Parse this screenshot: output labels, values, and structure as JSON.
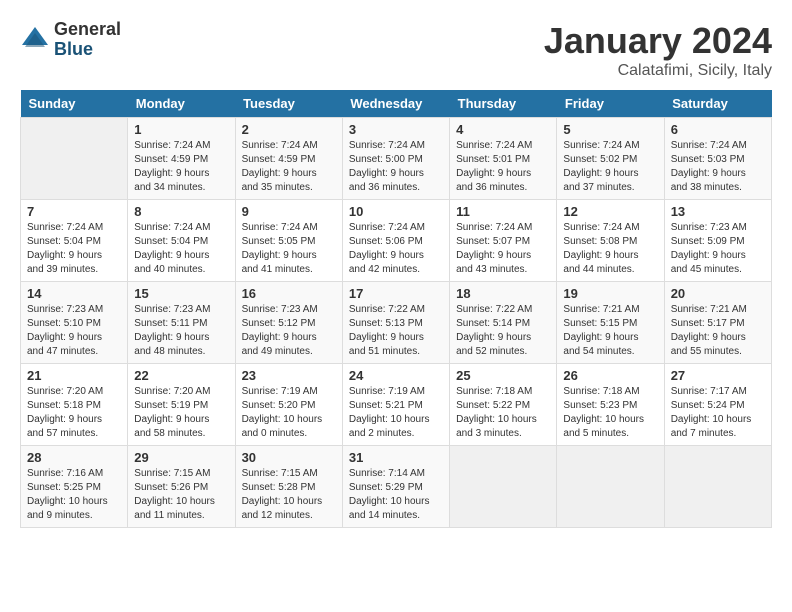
{
  "logo": {
    "general": "General",
    "blue": "Blue"
  },
  "title": "January 2024",
  "location": "Calatafimi, Sicily, Italy",
  "days_of_week": [
    "Sunday",
    "Monday",
    "Tuesday",
    "Wednesday",
    "Thursday",
    "Friday",
    "Saturday"
  ],
  "weeks": [
    [
      {
        "day": "",
        "info": ""
      },
      {
        "day": "1",
        "info": "Sunrise: 7:24 AM\nSunset: 4:59 PM\nDaylight: 9 hours\nand 34 minutes."
      },
      {
        "day": "2",
        "info": "Sunrise: 7:24 AM\nSunset: 4:59 PM\nDaylight: 9 hours\nand 35 minutes."
      },
      {
        "day": "3",
        "info": "Sunrise: 7:24 AM\nSunset: 5:00 PM\nDaylight: 9 hours\nand 36 minutes."
      },
      {
        "day": "4",
        "info": "Sunrise: 7:24 AM\nSunset: 5:01 PM\nDaylight: 9 hours\nand 36 minutes."
      },
      {
        "day": "5",
        "info": "Sunrise: 7:24 AM\nSunset: 5:02 PM\nDaylight: 9 hours\nand 37 minutes."
      },
      {
        "day": "6",
        "info": "Sunrise: 7:24 AM\nSunset: 5:03 PM\nDaylight: 9 hours\nand 38 minutes."
      }
    ],
    [
      {
        "day": "7",
        "info": "Sunrise: 7:24 AM\nSunset: 5:04 PM\nDaylight: 9 hours\nand 39 minutes."
      },
      {
        "day": "8",
        "info": "Sunrise: 7:24 AM\nSunset: 5:04 PM\nDaylight: 9 hours\nand 40 minutes."
      },
      {
        "day": "9",
        "info": "Sunrise: 7:24 AM\nSunset: 5:05 PM\nDaylight: 9 hours\nand 41 minutes."
      },
      {
        "day": "10",
        "info": "Sunrise: 7:24 AM\nSunset: 5:06 PM\nDaylight: 9 hours\nand 42 minutes."
      },
      {
        "day": "11",
        "info": "Sunrise: 7:24 AM\nSunset: 5:07 PM\nDaylight: 9 hours\nand 43 minutes."
      },
      {
        "day": "12",
        "info": "Sunrise: 7:24 AM\nSunset: 5:08 PM\nDaylight: 9 hours\nand 44 minutes."
      },
      {
        "day": "13",
        "info": "Sunrise: 7:23 AM\nSunset: 5:09 PM\nDaylight: 9 hours\nand 45 minutes."
      }
    ],
    [
      {
        "day": "14",
        "info": "Sunrise: 7:23 AM\nSunset: 5:10 PM\nDaylight: 9 hours\nand 47 minutes."
      },
      {
        "day": "15",
        "info": "Sunrise: 7:23 AM\nSunset: 5:11 PM\nDaylight: 9 hours\nand 48 minutes."
      },
      {
        "day": "16",
        "info": "Sunrise: 7:23 AM\nSunset: 5:12 PM\nDaylight: 9 hours\nand 49 minutes."
      },
      {
        "day": "17",
        "info": "Sunrise: 7:22 AM\nSunset: 5:13 PM\nDaylight: 9 hours\nand 51 minutes."
      },
      {
        "day": "18",
        "info": "Sunrise: 7:22 AM\nSunset: 5:14 PM\nDaylight: 9 hours\nand 52 minutes."
      },
      {
        "day": "19",
        "info": "Sunrise: 7:21 AM\nSunset: 5:15 PM\nDaylight: 9 hours\nand 54 minutes."
      },
      {
        "day": "20",
        "info": "Sunrise: 7:21 AM\nSunset: 5:17 PM\nDaylight: 9 hours\nand 55 minutes."
      }
    ],
    [
      {
        "day": "21",
        "info": "Sunrise: 7:20 AM\nSunset: 5:18 PM\nDaylight: 9 hours\nand 57 minutes."
      },
      {
        "day": "22",
        "info": "Sunrise: 7:20 AM\nSunset: 5:19 PM\nDaylight: 9 hours\nand 58 minutes."
      },
      {
        "day": "23",
        "info": "Sunrise: 7:19 AM\nSunset: 5:20 PM\nDaylight: 10 hours\nand 0 minutes."
      },
      {
        "day": "24",
        "info": "Sunrise: 7:19 AM\nSunset: 5:21 PM\nDaylight: 10 hours\nand 2 minutes."
      },
      {
        "day": "25",
        "info": "Sunrise: 7:18 AM\nSunset: 5:22 PM\nDaylight: 10 hours\nand 3 minutes."
      },
      {
        "day": "26",
        "info": "Sunrise: 7:18 AM\nSunset: 5:23 PM\nDaylight: 10 hours\nand 5 minutes."
      },
      {
        "day": "27",
        "info": "Sunrise: 7:17 AM\nSunset: 5:24 PM\nDaylight: 10 hours\nand 7 minutes."
      }
    ],
    [
      {
        "day": "28",
        "info": "Sunrise: 7:16 AM\nSunset: 5:25 PM\nDaylight: 10 hours\nand 9 minutes."
      },
      {
        "day": "29",
        "info": "Sunrise: 7:15 AM\nSunset: 5:26 PM\nDaylight: 10 hours\nand 11 minutes."
      },
      {
        "day": "30",
        "info": "Sunrise: 7:15 AM\nSunset: 5:28 PM\nDaylight: 10 hours\nand 12 minutes."
      },
      {
        "day": "31",
        "info": "Sunrise: 7:14 AM\nSunset: 5:29 PM\nDaylight: 10 hours\nand 14 minutes."
      },
      {
        "day": "",
        "info": ""
      },
      {
        "day": "",
        "info": ""
      },
      {
        "day": "",
        "info": ""
      }
    ]
  ]
}
